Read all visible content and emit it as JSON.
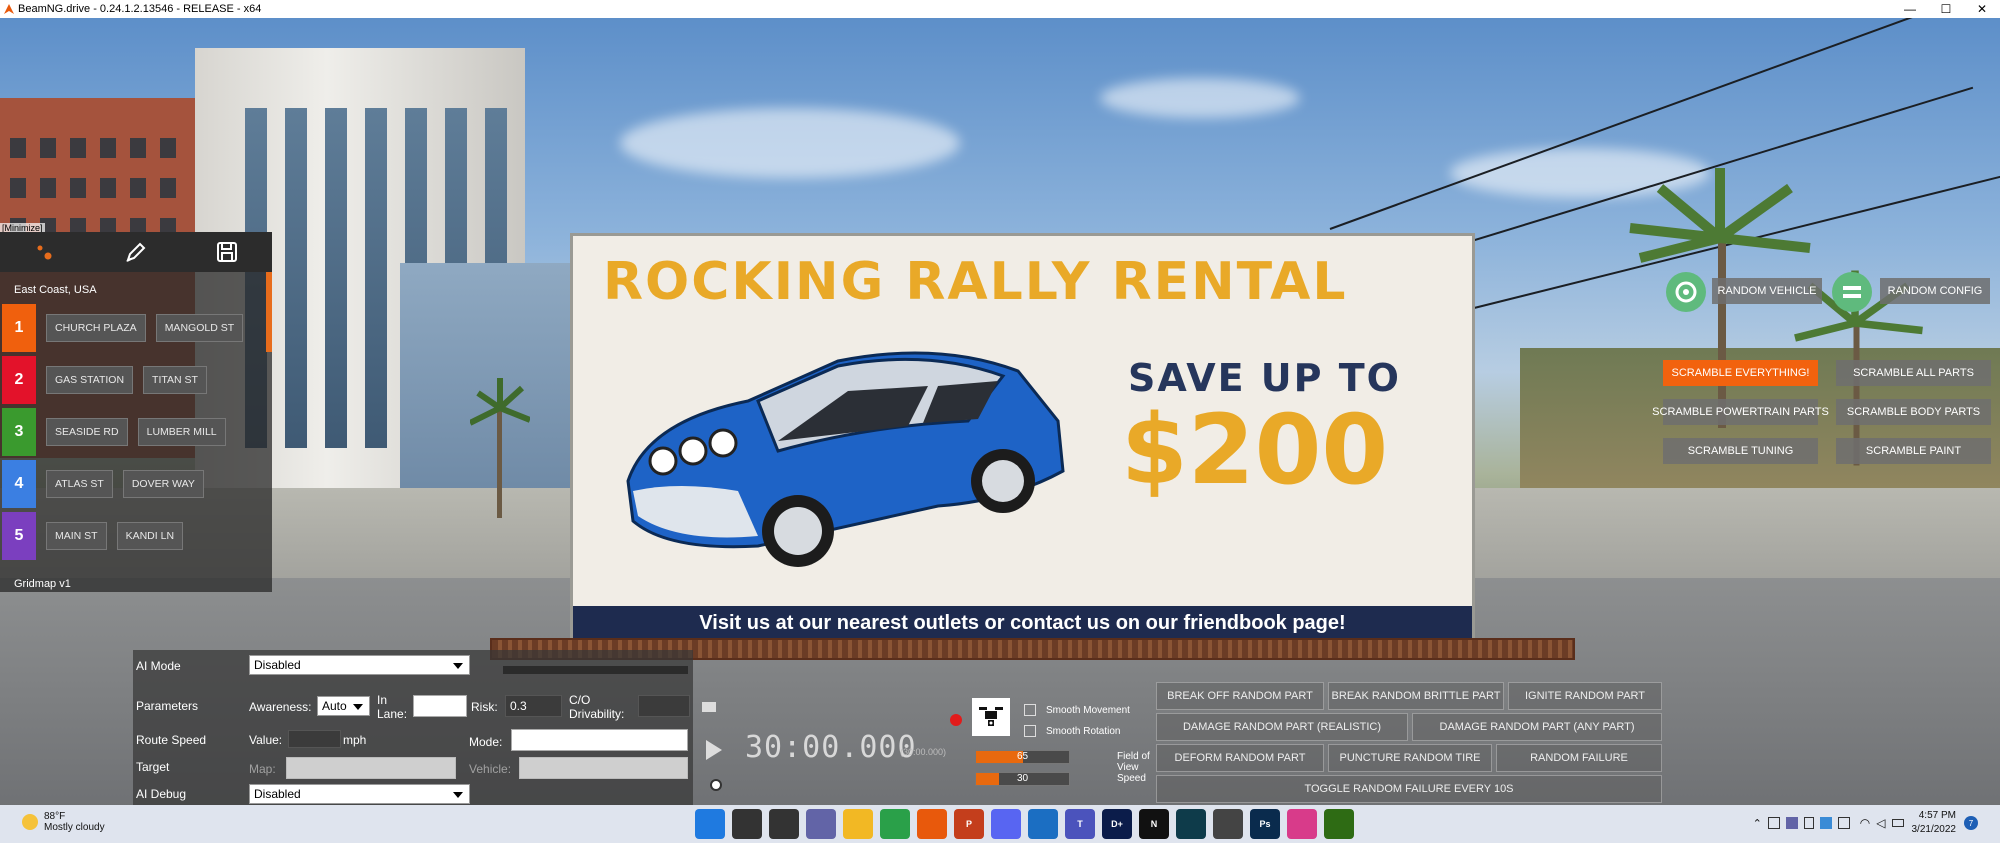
{
  "window": {
    "title": "BeamNG.drive - 0.24.1.2.13546 - RELEASE - x64",
    "controls": [
      "—",
      "☐",
      "✕"
    ]
  },
  "billboard": {
    "headline": "ROCKING RALLY RENTAL",
    "save": "SAVE UP TO",
    "price": "$200",
    "footer": "Visit us at our nearest outlets or contact us on our friendbook page!"
  },
  "gridmap": {
    "minimize_label": "[Minimize]",
    "region": "East Coast, USA",
    "footer": "Gridmap v1",
    "accent": "#e76c1c",
    "rows": [
      {
        "num": "1",
        "color": "#f0600d",
        "a": "CHURCH PLAZA",
        "b": "MANGOLD ST"
      },
      {
        "num": "2",
        "color": "#e3122a",
        "a": "GAS STATION",
        "b": "TITAN ST"
      },
      {
        "num": "3",
        "color": "#3a9a2e",
        "a": "SEASIDE RD",
        "b": "LUMBER MILL"
      },
      {
        "num": "4",
        "color": "#3b7fe2",
        "a": "ATLAS ST",
        "b": "DOVER WAY"
      },
      {
        "num": "5",
        "color": "#7b3fbf",
        "a": "MAIN ST",
        "b": "KANDI LN"
      }
    ]
  },
  "ai": {
    "mode_label": "AI Mode",
    "mode_value": "Disabled",
    "params_label": "Parameters",
    "awareness_label": "Awareness:",
    "awareness_value": "Auto",
    "in_lane_label": "In Lane:",
    "in_lane_value": "",
    "risk_label": "Risk:",
    "risk_value": "0.3",
    "co_label": "C/O Drivability:",
    "co_value": "",
    "route_label": "Route Speed",
    "value_label": "Value:",
    "value_value": "",
    "unit": "mph",
    "route_mode_label": "Mode:",
    "route_mode_value": "",
    "target_label": "Target",
    "map_label": "Map:",
    "map_value": "",
    "vehicle_label": "Vehicle:",
    "vehicle_value": "",
    "debug_label": "AI Debug",
    "debug_value": "Disabled"
  },
  "replay": {
    "time": "30:00.000",
    "time_small": "(30:00.000)"
  },
  "camera": {
    "smooth_movement": "Smooth Movement",
    "smooth_rotation": "Smooth Rotation",
    "fov_value": "65",
    "fov_fraction": 0.5,
    "fov_label": "Field of View",
    "speed_value": "30",
    "speed_fraction": 0.25,
    "speed_label": "Speed"
  },
  "damage": {
    "buttons": [
      "BREAK OFF RANDOM PART",
      "BREAK RANDOM BRITTLE PART",
      "IGNITE RANDOM PART",
      "DAMAGE RANDOM PART (REALISTIC)",
      "DAMAGE RANDOM PART (ANY PART)",
      "DEFORM RANDOM PART",
      "PUNCTURE RANDOM TIRE",
      "RANDOM FAILURE",
      "TOGGLE RANDOM FAILURE EVERY 10S"
    ]
  },
  "randomizer": {
    "random_vehicle": "RANDOM VEHICLE",
    "random_config": "RANDOM CONFIG",
    "scramble_everything": "SCRAMBLE EVERYTHING!",
    "scramble_all_parts": "SCRAMBLE ALL PARTS",
    "scramble_powertrain": "SCRAMBLE POWERTRAIN PARTS",
    "scramble_body": "SCRAMBLE BODY PARTS",
    "scramble_tuning": "SCRAMBLE TUNING",
    "scramble_paint": "SCRAMBLE PAINT",
    "accent": "#f2620e"
  },
  "taskbar": {
    "temperature": "88°F",
    "weather": "Mostly cloudy",
    "time": "4:57 PM",
    "date": "3/21/2022",
    "notification_count": "7",
    "app_icons": [
      {
        "name": "windows-start-icon",
        "color": "#1f7ae0",
        "label": ""
      },
      {
        "name": "search-icon",
        "color": "#333333",
        "label": ""
      },
      {
        "name": "task-view-icon",
        "color": "#333333",
        "label": ""
      },
      {
        "name": "teams-chat-icon",
        "color": "#6264a7",
        "label": ""
      },
      {
        "name": "file-explorer-icon",
        "color": "#f2b824",
        "label": ""
      },
      {
        "name": "chrome-icon",
        "color": "#2aa049",
        "label": ""
      },
      {
        "name": "beamng-icon",
        "color": "#e8590c",
        "label": ""
      },
      {
        "name": "powerpoint-icon",
        "color": "#c43e1c",
        "label": "P"
      },
      {
        "name": "discord-icon",
        "color": "#5865f2",
        "label": ""
      },
      {
        "name": "video-editor-icon",
        "color": "#1b6ec2",
        "label": ""
      },
      {
        "name": "teams-icon",
        "color": "#4b53bc",
        "label": "T"
      },
      {
        "name": "disney-plus-icon",
        "color": "#0b1c4a",
        "label": "D+"
      },
      {
        "name": "netflix-icon",
        "color": "#111111",
        "label": "N"
      },
      {
        "name": "app-icon-dark",
        "color": "#0e3b4a",
        "label": ""
      },
      {
        "name": "unity-icon",
        "color": "#444444",
        "label": ""
      },
      {
        "name": "photoshop-icon",
        "color": "#0a2b4d",
        "label": "Ps"
      },
      {
        "name": "headset-app-icon",
        "color": "#d83b8a",
        "label": ""
      },
      {
        "name": "nvidia-icon",
        "color": "#2e6b14",
        "label": ""
      }
    ]
  }
}
